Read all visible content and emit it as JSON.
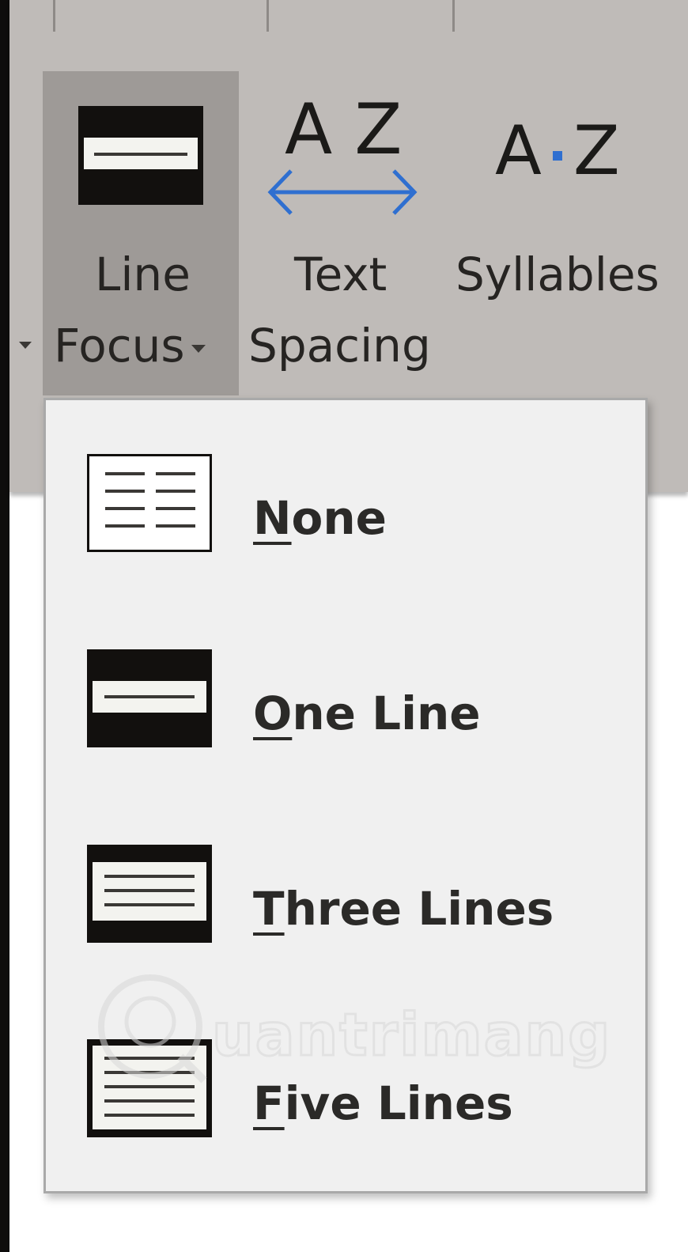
{
  "ribbon": {
    "line_focus": {
      "line1": "Line",
      "line2": "Focus"
    },
    "text_spacing": {
      "icon_text": "AZ",
      "line1": "Text",
      "line2": "Spacing"
    },
    "syllables": {
      "icon_left": "A",
      "icon_right": "Z",
      "label": "Syllables"
    },
    "colors": {
      "ribbon_bg": "#bfbbb8",
      "selected_bg": "#9e9a97",
      "arrow_blue": "#2f6fd0",
      "dot_blue": "#2f6fd0"
    }
  },
  "menu": {
    "items": [
      {
        "accel": "N",
        "rest": "one",
        "icon": "line-focus-none-icon"
      },
      {
        "accel": "O",
        "rest": "ne Line",
        "icon": "line-focus-one-line-icon"
      },
      {
        "accel": "T",
        "rest": "hree Lines",
        "icon": "line-focus-three-lines-icon"
      },
      {
        "accel": "F",
        "rest": "ive Lines",
        "icon": "line-focus-five-lines-icon"
      }
    ]
  },
  "watermark": {
    "text": "uantrimang"
  }
}
